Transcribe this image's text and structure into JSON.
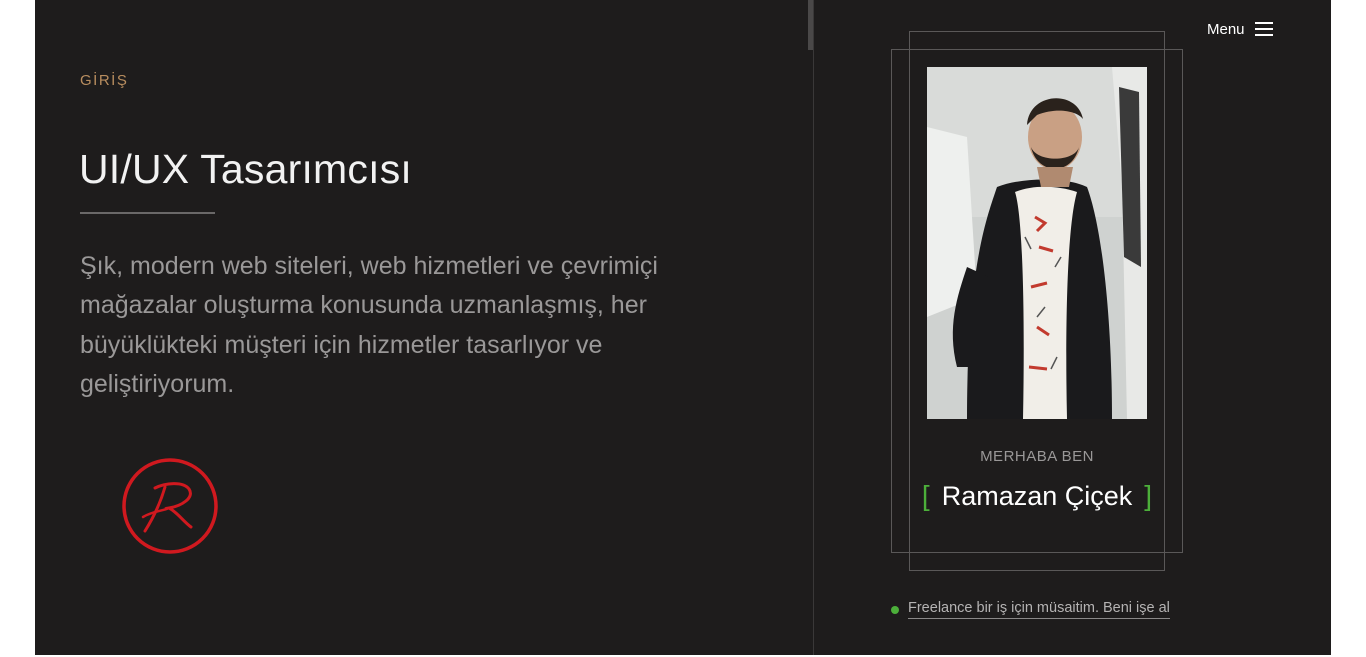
{
  "intro": {
    "section_label": "GİRİŞ",
    "title": "UI/UX Tasarımcısı",
    "description": "Şık, modern web siteleri, web hizmetleri ve çevrimiçi mağazalar oluşturma konusunda uzmanlaşmış, her büyüklükteki müşteri için hizmetler tasarlıyor ve geliştiriyorum."
  },
  "nav": {
    "menu_label": "Menu",
    "menu_icon": "hamburger-icon"
  },
  "profile": {
    "greeting": "MERHABA BEN",
    "name": "Ramazan Çiçek",
    "bracket_left": "[",
    "bracket_right": "]"
  },
  "availability": {
    "text": "Freelance bir iş için müsaitim. Beni işe al"
  },
  "colors": {
    "background": "#1e1c1c",
    "accent_gold": "#b88d5f",
    "accent_green": "#4caf3a",
    "logo_red": "#d0191f"
  }
}
